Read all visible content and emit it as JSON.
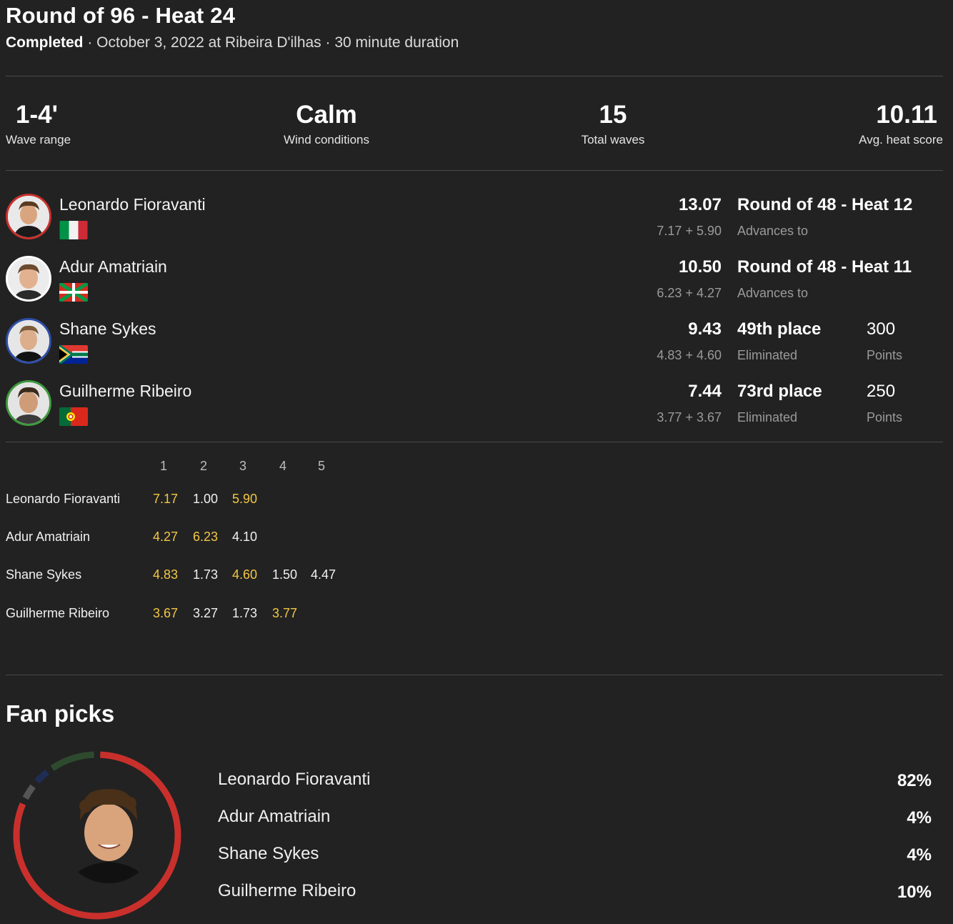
{
  "header": {
    "title": "Round of 96 - Heat 24",
    "status": "Completed",
    "details": " · October 3, 2022 at Ribeira D'ilhas · 30 minute duration"
  },
  "stats": [
    {
      "value": "1-4'",
      "label": "Wave range"
    },
    {
      "value": "Calm",
      "label": "Wind conditions"
    },
    {
      "value": "15",
      "label": "Total waves"
    },
    {
      "value": "10.11",
      "label": "Avg. heat score"
    }
  ],
  "surfers": [
    {
      "name": "Leonardo Fioravanti",
      "total": "13.07",
      "breakdown": "7.17 + 5.90",
      "result": "Round of 48 - Heat 12",
      "result_sub": "Advances to",
      "points": "",
      "points_sub": "",
      "ring_color": "#c9302c",
      "flag": "italy-flag-icon"
    },
    {
      "name": "Adur Amatriain",
      "total": "10.50",
      "breakdown": "6.23 + 4.27",
      "result": "Round of 48 - Heat 11",
      "result_sub": "Advances to",
      "points": "",
      "points_sub": "",
      "ring_color": "#ffffff",
      "flag": "basque-flag-icon"
    },
    {
      "name": "Shane Sykes",
      "total": "9.43",
      "breakdown": "4.83 + 4.60",
      "result": "49th place",
      "result_sub": "Eliminated",
      "points": "300",
      "points_sub": "Points",
      "ring_color": "#2f4fa8",
      "flag": "south-africa-flag-icon"
    },
    {
      "name": "Guilherme Ribeiro",
      "total": "7.44",
      "breakdown": "3.77 + 3.67",
      "result": "73rd place",
      "result_sub": "Eliminated",
      "points": "250",
      "points_sub": "Points",
      "ring_color": "#3f9a3f",
      "flag": "portugal-flag-icon"
    }
  ],
  "waves": {
    "headers": [
      "1",
      "2",
      "3",
      "4",
      "5"
    ],
    "rows": [
      {
        "name": "Leonardo Fioravanti",
        "scores": [
          "7.17",
          "1.00",
          "5.90"
        ],
        "highlight": [
          true,
          false,
          true
        ]
      },
      {
        "name": "Adur Amatriain",
        "scores": [
          "4.27",
          "6.23",
          "4.10"
        ],
        "highlight": [
          true,
          true,
          false
        ]
      },
      {
        "name": "Shane Sykes",
        "scores": [
          "4.83",
          "1.73",
          "4.60",
          "1.50",
          "4.47"
        ],
        "highlight": [
          true,
          false,
          true,
          false,
          false
        ]
      },
      {
        "name": "Guilherme Ribeiro",
        "scores": [
          "3.67",
          "3.27",
          "1.73",
          "3.77"
        ],
        "highlight": [
          true,
          false,
          false,
          true
        ]
      }
    ],
    "highlight_color": "#f2c744"
  },
  "fan_picks": {
    "title": "Fan picks",
    "items": [
      {
        "name": "Leonardo Fioravanti",
        "pct": "82%",
        "value": 82,
        "color": "#c9302c"
      },
      {
        "name": "Adur Amatriain",
        "pct": "4%",
        "value": 4,
        "color": "#555555"
      },
      {
        "name": "Shane Sykes",
        "pct": "4%",
        "value": 4,
        "color": "#1f2d55"
      },
      {
        "name": "Guilherme Ribeiro",
        "pct": "10%",
        "value": 10,
        "color": "#2e4a2e"
      }
    ]
  }
}
